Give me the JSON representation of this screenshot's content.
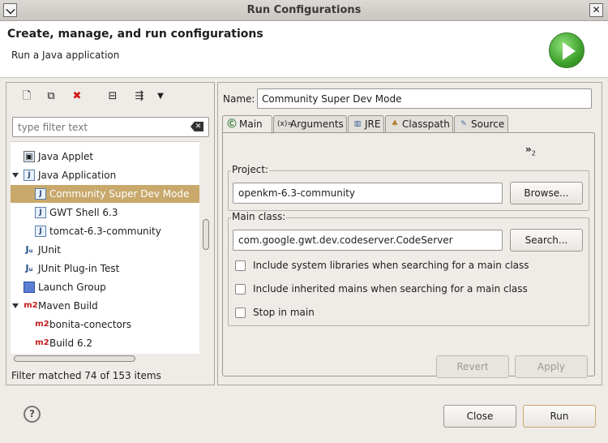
{
  "window": {
    "title": "Run Configurations"
  },
  "header": {
    "title": "Create, manage, and run configurations",
    "subtitle": "Run a Java application"
  },
  "left": {
    "filter_placeholder": "type filter text",
    "tree": [
      {
        "label": "Java Applet",
        "icon": "applet-icon",
        "level": 1,
        "expanded": null,
        "selected": false
      },
      {
        "label": "Java Application",
        "icon": "java-app-icon",
        "level": 1,
        "expanded": true,
        "selected": false
      },
      {
        "label": "Community Super Dev Mode",
        "icon": "java-app-icon",
        "level": 2,
        "expanded": null,
        "selected": true
      },
      {
        "label": "GWT Shell 6.3",
        "icon": "java-app-icon",
        "level": 2,
        "expanded": null,
        "selected": false
      },
      {
        "label": "tomcat-6.3-community",
        "icon": "java-app-icon",
        "level": 2,
        "expanded": null,
        "selected": false
      },
      {
        "label": "JUnit",
        "icon": "junit-icon",
        "level": 1,
        "expanded": null,
        "selected": false
      },
      {
        "label": "JUnit Plug-in Test",
        "icon": "junit-plugin-icon",
        "level": 1,
        "expanded": null,
        "selected": false
      },
      {
        "label": "Launch Group",
        "icon": "launch-group-icon",
        "level": 1,
        "expanded": null,
        "selected": false
      },
      {
        "label": "Maven Build",
        "icon": "m2-icon",
        "level": 1,
        "expanded": true,
        "selected": false
      },
      {
        "label": "bonita-conectors",
        "icon": "m2-icon",
        "level": 2,
        "expanded": null,
        "selected": false
      },
      {
        "label": "Build 6.2",
        "icon": "m2-icon",
        "level": 2,
        "expanded": null,
        "selected": false
      }
    ],
    "status": "Filter matched 74 of 153 items"
  },
  "right": {
    "name_label": "Name:",
    "name_value": "Community Super Dev Mode",
    "tabs": [
      {
        "label": "Main",
        "icon": "main-tab-icon"
      },
      {
        "label": "Arguments",
        "icon": "arguments-tab-icon"
      },
      {
        "label": "JRE",
        "icon": "jre-tab-icon"
      },
      {
        "label": "Classpath",
        "icon": "classpath-tab-icon"
      },
      {
        "label": "Source",
        "icon": "source-tab-icon"
      }
    ],
    "overflow": "»",
    "overflow_count": "2",
    "project": {
      "label": "Project:",
      "value": "openkm-6.3-community",
      "button": "Browse..."
    },
    "main_class": {
      "label": "Main class:",
      "value": "com.google.gwt.dev.codeserver.CodeServer",
      "button": "Search..."
    },
    "options": [
      {
        "label": "Include system libraries when searching for a main class",
        "checked": false
      },
      {
        "label": "Include inherited mains when searching for a main class",
        "checked": false
      },
      {
        "label": "Stop in main",
        "checked": false
      }
    ],
    "revert_label": "Revert",
    "apply_label": "Apply"
  },
  "footer": {
    "close_label": "Close",
    "run_label": "Run",
    "help_glyph": "?"
  },
  "colors": {
    "selection": "#c8a86b",
    "accent_green": "#3ea12c",
    "m2_red": "#c21b1b"
  }
}
